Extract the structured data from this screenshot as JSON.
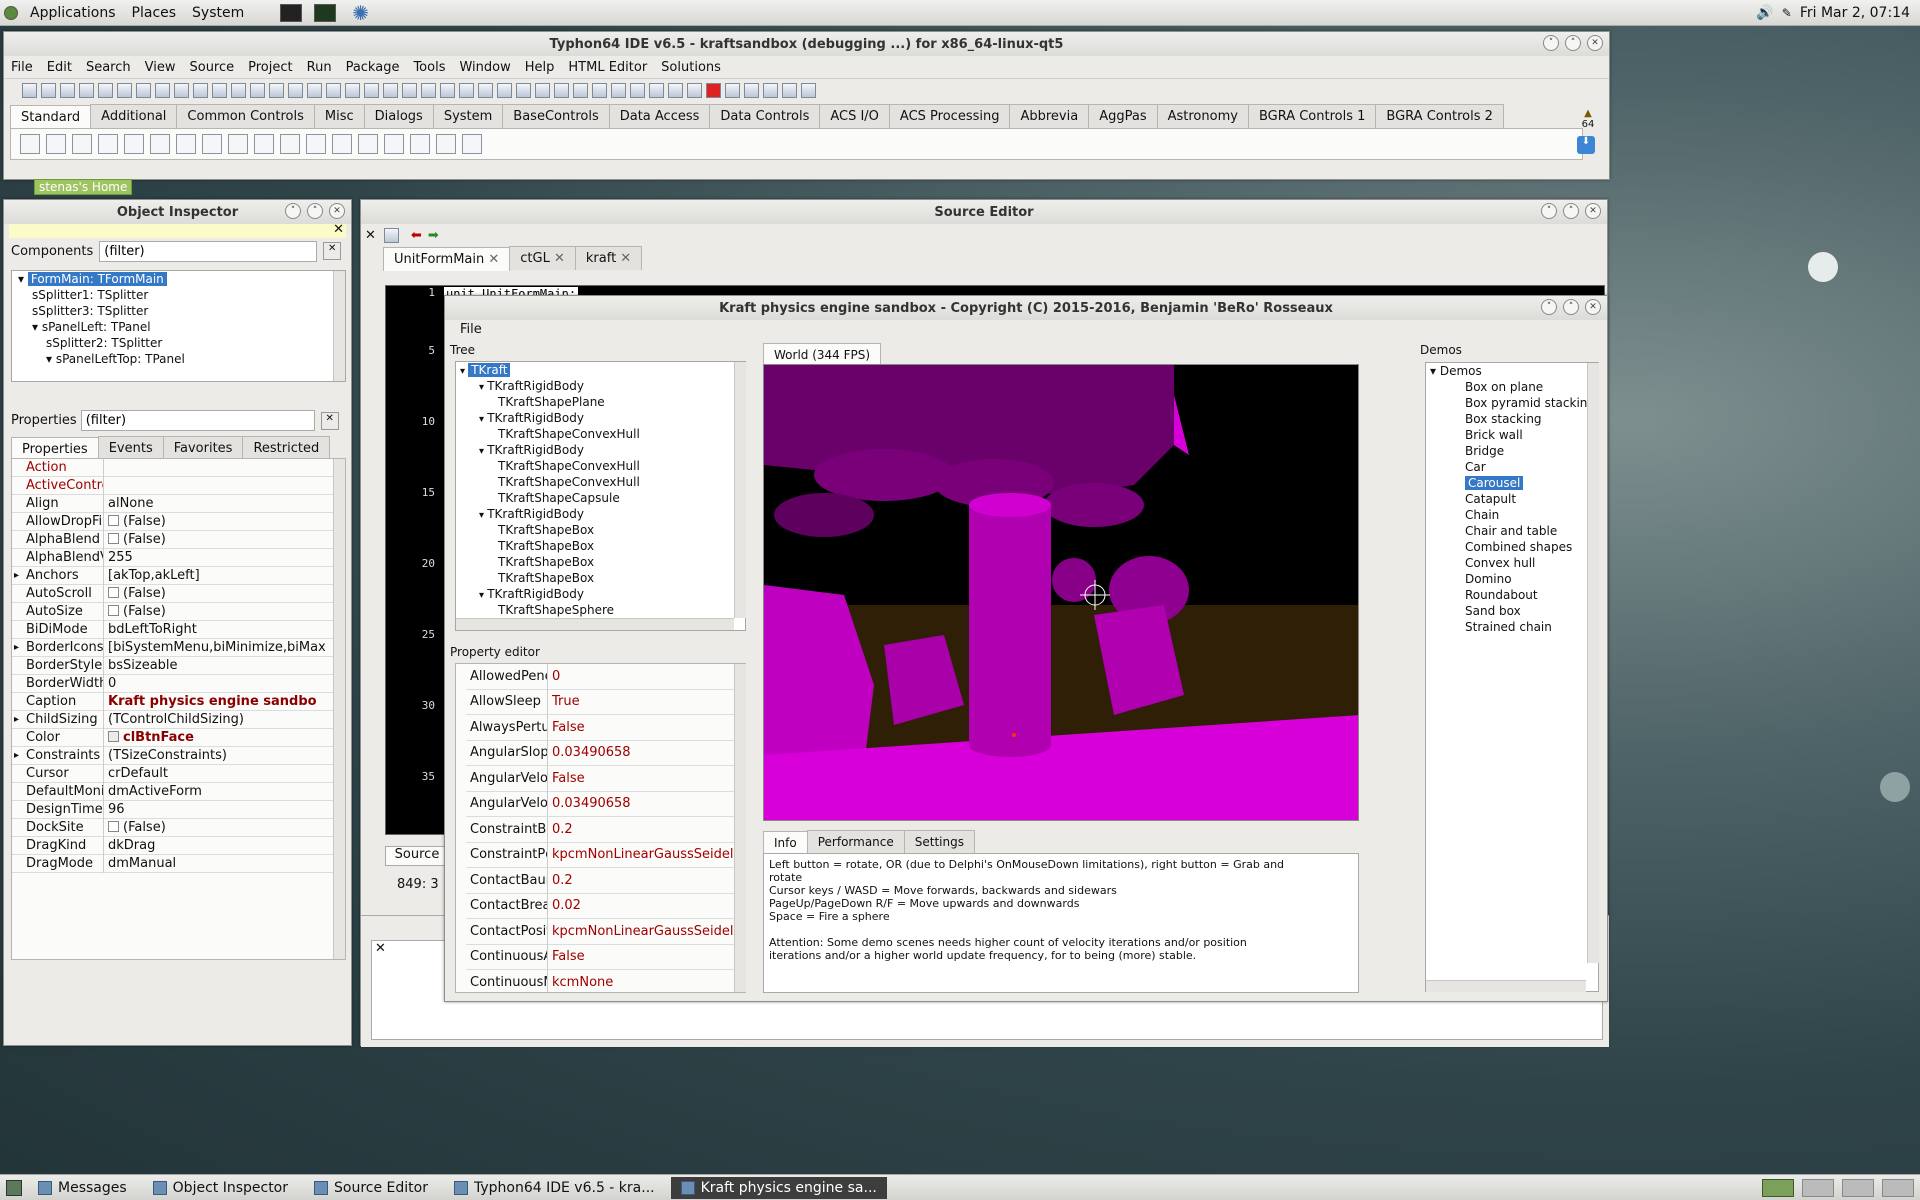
{
  "top_panel": {
    "menus": [
      "Applications",
      "Places",
      "System"
    ],
    "clock": "Fri Mar  2, 07:14"
  },
  "ide": {
    "title": "Typhon64 IDE v6.5 - kraftsandbox (debugging ...) for x86_64-linux-qt5",
    "menu": [
      "File",
      "Edit",
      "Search",
      "View",
      "Source",
      "Project",
      "Run",
      "Package",
      "Tools",
      "Window",
      "Help",
      "HTML Editor",
      "Solutions"
    ],
    "palette_tabs": [
      "Standard",
      "Additional",
      "Common Controls",
      "Misc",
      "Dialogs",
      "System",
      "BaseControls",
      "Data Access",
      "Data Controls",
      "ACS I/O",
      "ACS Processing",
      "Abbrevia",
      "AggPas",
      "Astronomy",
      "BGRA Controls 1",
      "BGRA Controls 2"
    ],
    "palette_badge": "64",
    "home_label": "stenas's Home"
  },
  "inspector": {
    "title": "Object Inspector",
    "components_label": "Components",
    "filter": "(filter)",
    "tree": [
      "FormMain: TFormMain",
      "sSplitter1: TSplitter",
      "sSplitter3: TSplitter",
      "sPanelLeft: TPanel",
      "sSplitter2: TSplitter",
      "sPanelLeftTop: TPanel"
    ],
    "properties_label": "Properties",
    "tabs": [
      "Properties",
      "Events",
      "Favorites",
      "Restricted"
    ],
    "rows": [
      {
        "n": "Action",
        "v": "",
        "red": true
      },
      {
        "n": "ActiveControl",
        "v": "",
        "red": true
      },
      {
        "n": "Align",
        "v": "alNone"
      },
      {
        "n": "AllowDropFiles",
        "v": "(False)",
        "chk": true
      },
      {
        "n": "AlphaBlend",
        "v": "(False)",
        "chk": true
      },
      {
        "n": "AlphaBlendVa",
        "v": "255"
      },
      {
        "n": "Anchors",
        "v": "[akTop,akLeft]",
        "exp": true
      },
      {
        "n": "AutoScroll",
        "v": "(False)",
        "chk": true
      },
      {
        "n": "AutoSize",
        "v": "(False)",
        "chk": true
      },
      {
        "n": "BiDiMode",
        "v": "bdLeftToRight"
      },
      {
        "n": "BorderIcons",
        "v": "[biSystemMenu,biMinimize,biMax",
        "exp": true
      },
      {
        "n": "BorderStyle",
        "v": "bsSizeable"
      },
      {
        "n": "BorderWidth",
        "v": "0"
      },
      {
        "n": "Caption",
        "v": "Kraft physics engine sandbo",
        "bold": true
      },
      {
        "n": "ChildSizing",
        "v": "(TControlChildSizing)",
        "exp": true
      },
      {
        "n": "Color",
        "v": "clBtnFace",
        "bold": true,
        "swatch": true
      },
      {
        "n": "Constraints",
        "v": "(TSizeConstraints)",
        "exp": true
      },
      {
        "n": "Cursor",
        "v": "crDefault"
      },
      {
        "n": "DefaultMonito",
        "v": "dmActiveForm"
      },
      {
        "n": "DesignTimePP",
        "v": "96"
      },
      {
        "n": "DockSite",
        "v": "(False)",
        "chk": true
      },
      {
        "n": "DragKind",
        "v": "dkDrag"
      },
      {
        "n": "DragMode",
        "v": "dmManual"
      }
    ]
  },
  "source_editor": {
    "title": "Source Editor",
    "tabs": [
      "UnitFormMain",
      "ctGL",
      "kraft"
    ],
    "first_line": "unit UnitFormMain;",
    "line_numbers": [
      "1",
      "5",
      "10",
      "15",
      "20",
      "25",
      "30",
      "35"
    ],
    "status": "849: 3",
    "bottom_tab": "Source"
  },
  "kraft": {
    "title": "Kraft physics engine sandbox - Copyright (C) 2015-2016, Benjamin 'BeRo' Rosseaux",
    "menu": [
      "File"
    ],
    "tree_label": "Tree",
    "tree": [
      {
        "t": "TKraft",
        "d": 0,
        "sel": true
      },
      {
        "t": "TKraftRigidBody",
        "d": 1
      },
      {
        "t": "TKraftShapePlane",
        "d": 2
      },
      {
        "t": "TKraftRigidBody",
        "d": 1
      },
      {
        "t": "TKraftShapeConvexHull",
        "d": 2
      },
      {
        "t": "TKraftRigidBody",
        "d": 1
      },
      {
        "t": "TKraftShapeConvexHull",
        "d": 2
      },
      {
        "t": "TKraftShapeConvexHull",
        "d": 2
      },
      {
        "t": "TKraftShapeCapsule",
        "d": 2
      },
      {
        "t": "TKraftRigidBody",
        "d": 1
      },
      {
        "t": "TKraftShapeBox",
        "d": 2
      },
      {
        "t": "TKraftShapeBox",
        "d": 2
      },
      {
        "t": "TKraftShapeBox",
        "d": 2
      },
      {
        "t": "TKraftShapeBox",
        "d": 2
      },
      {
        "t": "TKraftRigidBody",
        "d": 1
      },
      {
        "t": "TKraftShapeSphere",
        "d": 2
      }
    ],
    "prop_label": "Property editor",
    "props": [
      {
        "n": "AllowedPene",
        "v": "0"
      },
      {
        "n": "AllowSleep",
        "v": "True"
      },
      {
        "n": "AlwaysPertur",
        "v": "False"
      },
      {
        "n": "AngularSlop",
        "v": "0.03490658"
      },
      {
        "n": "AngularVeloc",
        "v": "False"
      },
      {
        "n": "AngularVeloc",
        "v": "0.03490658"
      },
      {
        "n": "ConstraintBa",
        "v": "0.2"
      },
      {
        "n": "ConstraintPc",
        "v": "kpcmNonLinearGaussSeidel"
      },
      {
        "n": "ContactBaum",
        "v": "0.2"
      },
      {
        "n": "ContactBrea",
        "v": "0.02"
      },
      {
        "n": "ContactPosit",
        "v": "kpcmNonLinearGaussSeidel"
      },
      {
        "n": "ContinuousA",
        "v": "False"
      },
      {
        "n": "ContinuousM",
        "v": "kcmNone"
      }
    ],
    "world_tab": "World (344 FPS)",
    "info_tabs": [
      "Info",
      "Performance",
      "Settings"
    ],
    "info_lines": [
      "Left button = rotate, OR (due to Delphi's OnMouseDown limitations), right button = Grab and",
      "rotate",
      "Cursor keys / WASD = Move forwards, backwards and sidewars",
      "PageUp/PageDown R/F = Move upwards and downwards",
      "Space = Fire a sphere",
      "",
      "Attention: Some demo scenes needs higher count of velocity iterations and/or position",
      "iterations and/or a higher world update frequency, for to being (more) stable."
    ],
    "demos_label": "Demos",
    "demos_root": "Demos",
    "demos": [
      "Box on plane",
      "Box pyramid stacking",
      "Box stacking",
      "Brick wall",
      "Bridge",
      "Car",
      "Carousel",
      "Catapult",
      "Chain",
      "Chair and table",
      "Combined shapes",
      "Convex hull",
      "Domino",
      "Roundabout",
      "Sand box",
      "Strained chain"
    ],
    "demos_selected": "Carousel"
  },
  "taskbar": [
    "Messages",
    "Object Inspector",
    "Source Editor",
    "Typhon64 IDE v6.5 - kra...",
    "Kraft physics engine sa..."
  ],
  "colors": {
    "magenta": "#d800d8",
    "selection": "#3478c6",
    "value_red": "#a00000"
  }
}
